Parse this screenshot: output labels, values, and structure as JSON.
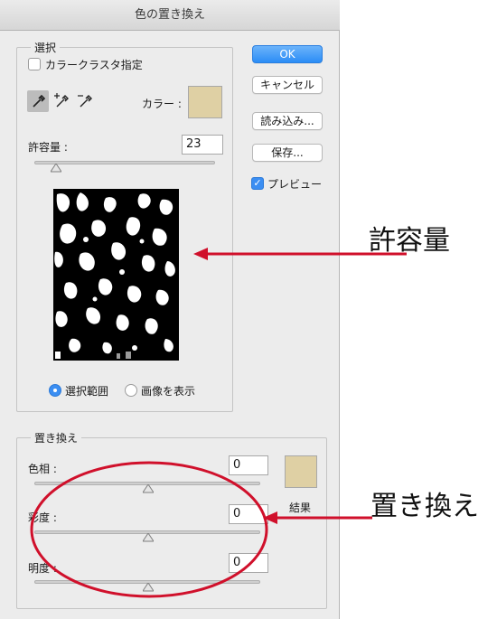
{
  "dialog": {
    "title": "色の置き換え"
  },
  "selection": {
    "legend": "選択",
    "localized_clusters_label": "カラークラスタ指定",
    "color_label": "カラー :",
    "tolerance_label": "許容量 :",
    "tolerance_value": "23",
    "tolerance_fraction": 0.11,
    "radio_selection": "選択範囲",
    "radio_image": "画像を表示",
    "selected_radio": "selection",
    "color_swatch": "#dfd0a4"
  },
  "buttons": {
    "ok": "OK",
    "cancel": "キャンセル",
    "load": "読み込み...",
    "save": "保存...",
    "preview": "プレビュー"
  },
  "replacement": {
    "legend": "置き換え",
    "hue_label": "色相 :",
    "hue_value": "0",
    "saturation_label": "彩度 :",
    "saturation_value": "0",
    "lightness_label": "明度 :",
    "lightness_value": "0",
    "result_label": "結果",
    "result_swatch": "#dfd0a4"
  },
  "annotations": {
    "tolerance": "許容量",
    "replace": "置き換え"
  },
  "colors": {
    "accent": "#3b8ef2",
    "annotation_red": "#d0102b"
  }
}
